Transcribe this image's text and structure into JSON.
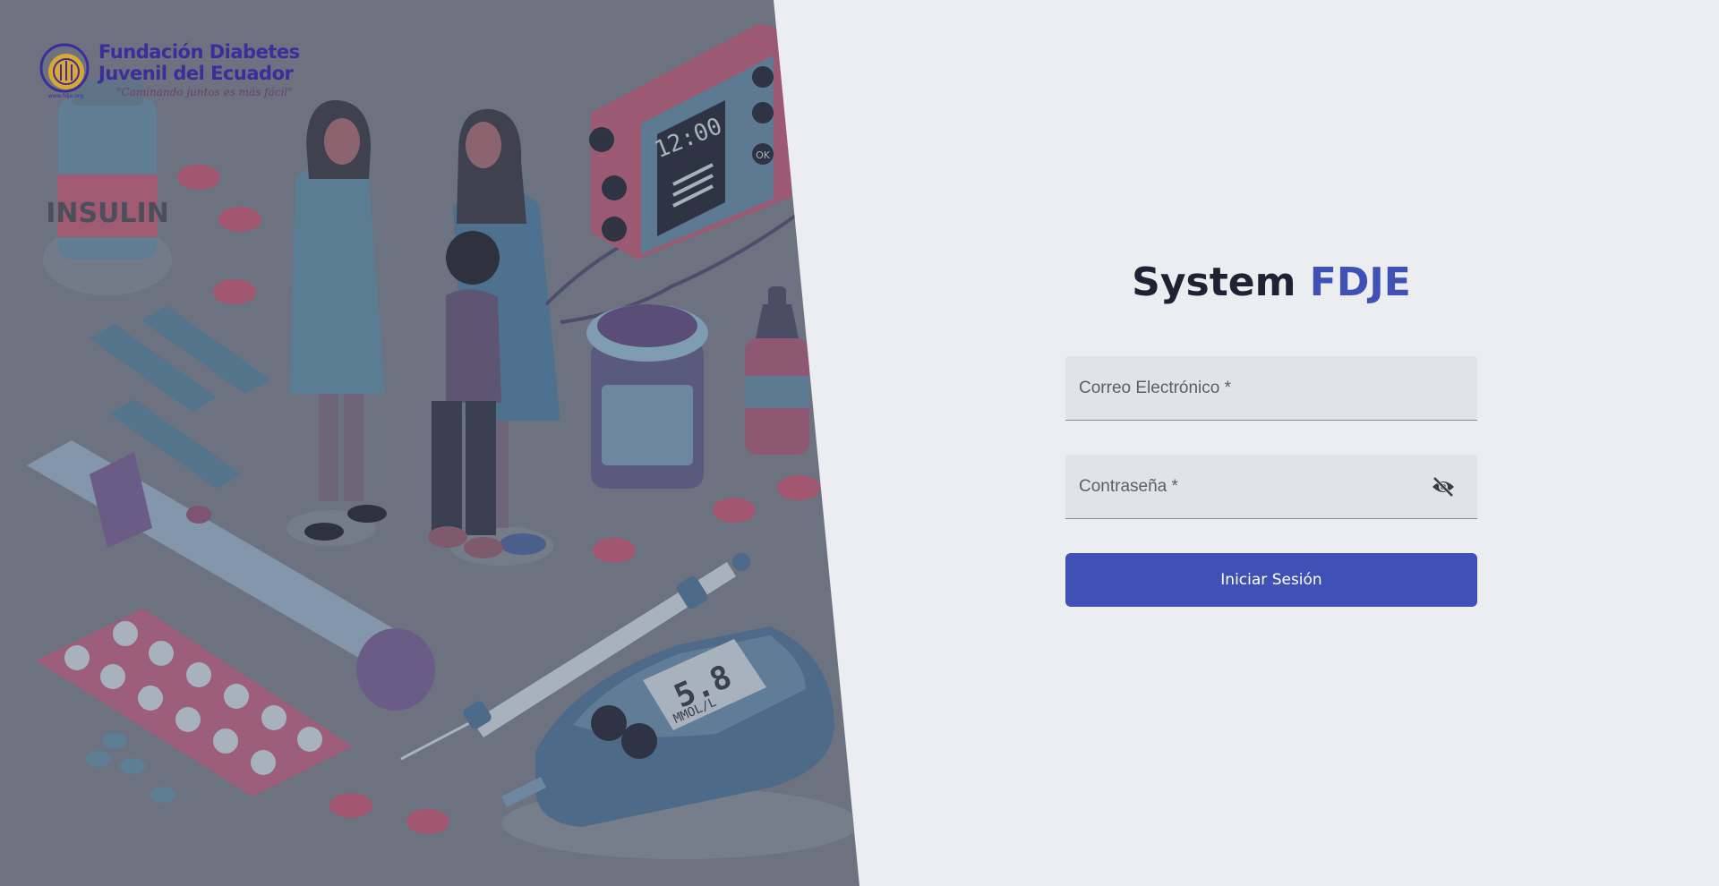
{
  "brand": {
    "name_line1": "Fundación Diabetes",
    "name_line2": "Juvenil del Ecuador",
    "slogan": "\"Caminando juntos es más fácil\"",
    "url": "www.fdje.org",
    "name_color": "#3b2d9a"
  },
  "illustration": {
    "insulin_label": "INSULIN",
    "pump_time": "12:00",
    "pump_ok": "OK",
    "meter_reading": "5.8",
    "meter_unit": "MMOL/L"
  },
  "login": {
    "title_plain": "System",
    "title_accent": "FDJE",
    "email_placeholder": "Correo Electrónico *",
    "password_placeholder": "Contraseña *",
    "password_toggle_icon": "eye-off-icon",
    "submit_label": "Iniciar Sesión"
  },
  "colors": {
    "accent": "#3f51b5",
    "background": "#ecedf1",
    "overlay": "#6c7280"
  }
}
